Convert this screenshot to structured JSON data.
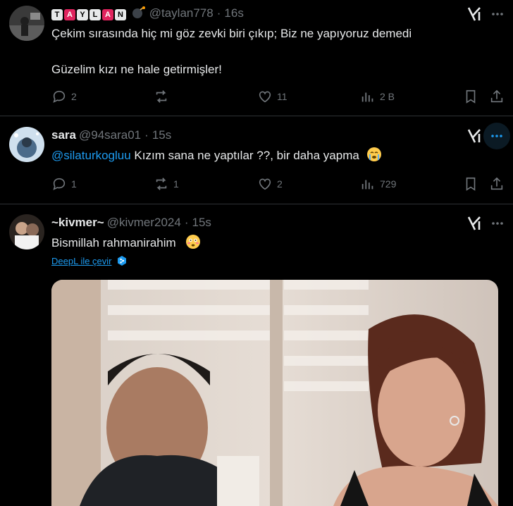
{
  "tweets": [
    {
      "name_letters": [
        "T",
        "A",
        "Y",
        "L",
        "A",
        "N"
      ],
      "handle": "@taylan778",
      "time": "16s",
      "lines": [
        "Çekim sırasında hiç mi göz zevki biri çıkıp; Biz ne yapıyoruz demedi",
        "Güzelim kızı ne hale getirmişler!"
      ],
      "replies": "2",
      "retweets": "",
      "likes": "11",
      "views": "2 B"
    },
    {
      "name": "sara",
      "handle": "@94sara01",
      "time": "15s",
      "mention": "@silaturkogluu",
      "text": " Kızım sana ne yaptılar ??, bir daha yapma",
      "replies": "1",
      "retweets": "1",
      "likes": "2",
      "views": "729"
    },
    {
      "name": "~kivmer~",
      "handle": "@kivmer2024",
      "time": "15s",
      "text": "Bismillah rahmanirahim",
      "translate": "DeepL ile çevir"
    }
  ],
  "dot": "·",
  "colors": {
    "accent": "#1d9bf0",
    "muted": "#71767b",
    "text": "#e7e9ea",
    "divider": "#2f3336"
  },
  "icons": [
    "grok-icon",
    "more-icon",
    "reply-icon",
    "retweet-icon",
    "like-icon",
    "views-icon",
    "bookmark-icon",
    "share-icon",
    "deepl-icon"
  ]
}
